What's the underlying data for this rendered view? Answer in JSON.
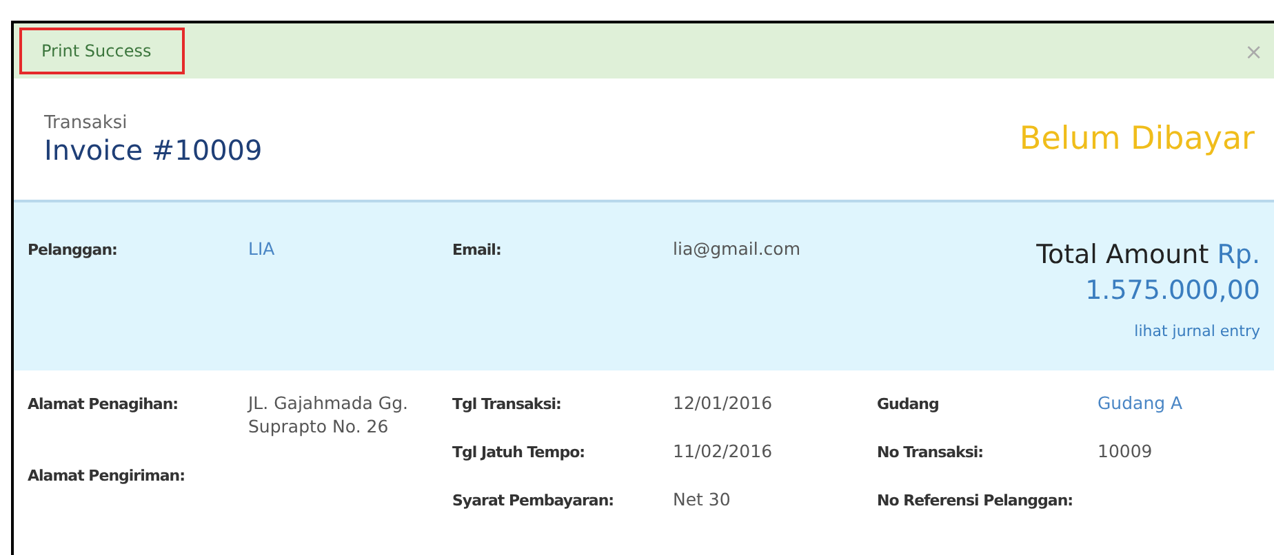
{
  "alert": {
    "message": "Print Success",
    "close": "×"
  },
  "header": {
    "subtitle": "Transaksi",
    "title": "Invoice #10009",
    "status": "Belum Dibayar"
  },
  "summary": {
    "fields": [
      {
        "label": "Pelanggan:",
        "value": "LIA",
        "kind": "link"
      },
      {
        "label": "Email:",
        "value": "lia@gmail.com",
        "kind": "text"
      }
    ],
    "total": {
      "label": "Total Amount",
      "currency": "Rp.",
      "amount": "1.575.000,00",
      "link": "lihat jurnal entry"
    }
  },
  "details": {
    "columns": [
      [
        {
          "label": "Alamat Penagihan:",
          "value": "JL. Gajahmada Gg. Suprapto No. 26",
          "kind": "text"
        },
        {
          "label": "Alamat Pengiriman:"
        }
      ],
      [
        {
          "label": "Tgl Transaksi:",
          "value": "12/01/2016",
          "kind": "text"
        },
        {
          "label": "Tgl Jatuh Tempo:",
          "value": "11/02/2016",
          "kind": "text"
        },
        {
          "label": "Syarat Pembayaran:",
          "value": "Net 30",
          "kind": "text"
        }
      ],
      [
        {
          "label": "Gudang",
          "value": "Gudang A",
          "kind": "link"
        },
        {
          "label": "No Transaksi:",
          "value": "10009",
          "kind": "text"
        },
        {
          "label": "No Referensi Pelanggan:"
        }
      ]
    ]
  }
}
